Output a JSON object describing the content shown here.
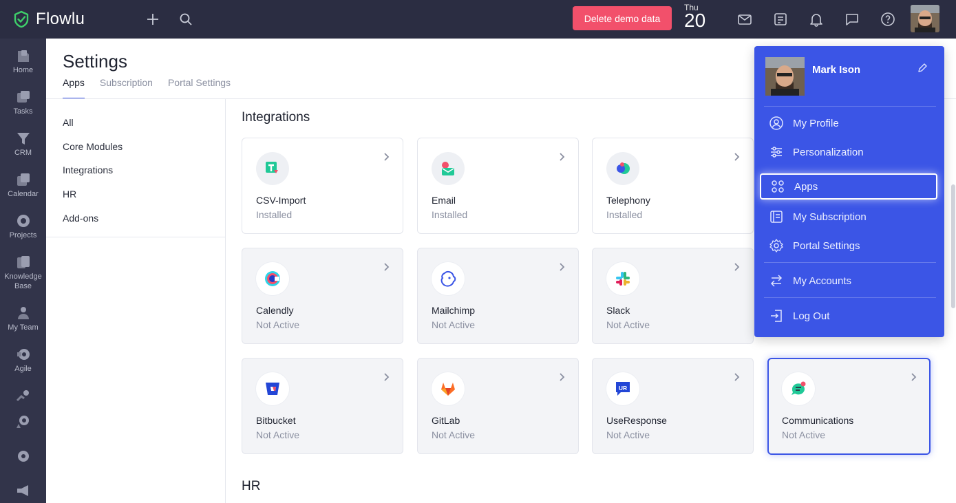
{
  "topbar": {
    "app_name": "Flowlu",
    "demo_button": "Delete demo data",
    "date_dow": "Thu",
    "date_day": "20"
  },
  "sidebar": {
    "items": [
      {
        "label": "Home",
        "icon": "home-icon"
      },
      {
        "label": "Tasks",
        "icon": "tasks-icon"
      },
      {
        "label": "CRM",
        "icon": "crm-icon"
      },
      {
        "label": "Calendar",
        "icon": "calendar-icon"
      },
      {
        "label": "Projects",
        "icon": "projects-icon"
      },
      {
        "label": "Knowledge Base",
        "icon": "knowledge-base-icon"
      },
      {
        "label": "My Team",
        "icon": "team-icon"
      },
      {
        "label": "Agile",
        "icon": "agile-icon"
      }
    ]
  },
  "page": {
    "title": "Settings",
    "tabs": [
      {
        "label": "Apps",
        "active": true
      },
      {
        "label": "Subscription",
        "active": false
      },
      {
        "label": "Portal Settings",
        "active": false
      }
    ]
  },
  "leftnav": {
    "items": [
      "All",
      "Core Modules",
      "Integrations",
      "HR",
      "Add-ons"
    ]
  },
  "sections": {
    "integrations": "Integrations",
    "hr": "HR"
  },
  "cards": [
    {
      "name": "CSV-Import",
      "status": "Installed"
    },
    {
      "name": "Email",
      "status": "Installed"
    },
    {
      "name": "Telephony",
      "status": "Installed"
    },
    {
      "name": "Calendly",
      "status": "Not Active"
    },
    {
      "name": "Mailchimp",
      "status": "Not Active"
    },
    {
      "name": "Slack",
      "status": "Not Active"
    },
    {
      "name": "Bitbucket",
      "status": "Not Active"
    },
    {
      "name": "GitLab",
      "status": "Not Active"
    },
    {
      "name": "UseResponse",
      "status": "Not Active"
    },
    {
      "name": "Communications",
      "status": "Not Active"
    }
  ],
  "dropdown": {
    "user_name": "Mark Ison",
    "items": [
      {
        "label": "My Profile",
        "icon": "user-circle-icon"
      },
      {
        "label": "Personalization",
        "icon": "sliders-icon"
      },
      {
        "label": "Apps",
        "icon": "apps-grid-icon",
        "active": true
      },
      {
        "label": "My Subscription",
        "icon": "subscription-icon"
      },
      {
        "label": "Portal Settings",
        "icon": "gear-icon"
      },
      {
        "label": "My Accounts",
        "icon": "switch-arrows-icon"
      },
      {
        "label": "Log Out",
        "icon": "logout-icon"
      }
    ]
  },
  "colors": {
    "topbar": "#2b2d42",
    "sidebar": "#32344a",
    "accent": "#3b55e6",
    "demo_button": "#f2506b"
  }
}
